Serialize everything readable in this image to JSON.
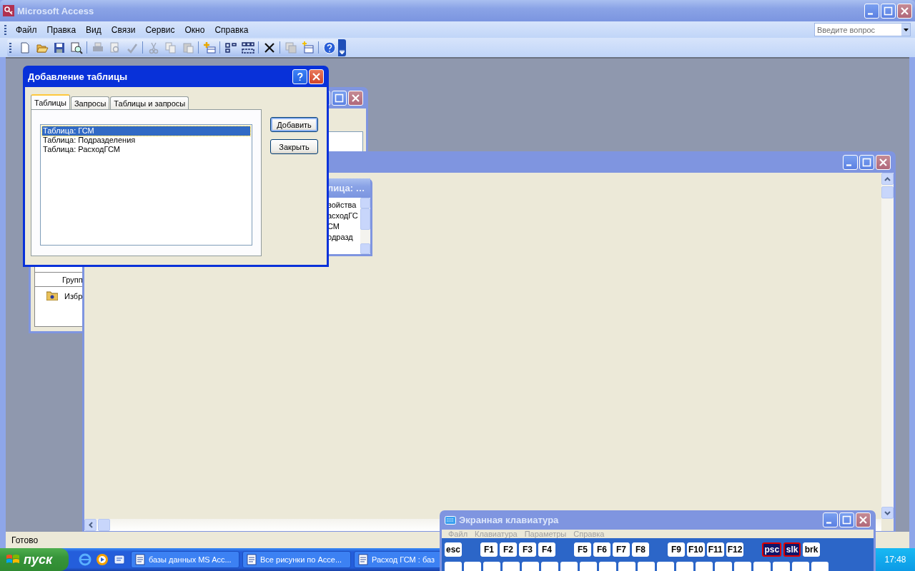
{
  "app": {
    "title": "Microsoft Access"
  },
  "menu": [
    "Файл",
    "Правка",
    "Вид",
    "Связи",
    "Сервис",
    "Окно",
    "Справка"
  ],
  "help_search": {
    "placeholder": "Введите вопрос"
  },
  "database_window": {
    "group_header": "Групп",
    "items": [
      {
        "label": "Избр"
      }
    ]
  },
  "table_box": {
    "title": "лица: …",
    "fields": [
      "войства",
      "асходГС",
      "СМ",
      "одразд"
    ]
  },
  "dialog": {
    "title": "Добавление таблицы",
    "tabs": [
      {
        "label": "Таблицы",
        "selected": true
      },
      {
        "label": "Запросы",
        "selected": false
      },
      {
        "label": "Таблицы и запросы",
        "selected": false
      }
    ],
    "items": [
      {
        "label": "Таблица: ГСМ",
        "selected": true
      },
      {
        "label": "Таблица: Подразделения",
        "selected": false
      },
      {
        "label": "Таблица: РасходГСМ",
        "selected": false
      }
    ],
    "buttons": [
      {
        "label": "Добавить",
        "default": true
      },
      {
        "label": "Закрыть",
        "default": false
      }
    ]
  },
  "status_bar": "Готово",
  "taskbar": {
    "start": "пуск",
    "tasks": [
      "базы данных MS Acc...",
      "Все рисунки по Acce...",
      "Расход ГСМ : баз"
    ],
    "clock": "17:48"
  },
  "keyboard": {
    "title": "Экранная клавиатура",
    "menu": [
      "Файл",
      "Клавиатура",
      "Параметры",
      "Справка"
    ],
    "key_groups": [
      [
        {
          "label": "esc",
          "on": false
        }
      ],
      [
        {
          "label": "F1",
          "on": false
        },
        {
          "label": "F2",
          "on": false
        },
        {
          "label": "F3",
          "on": false
        },
        {
          "label": "F4",
          "on": false
        }
      ],
      [
        {
          "label": "F5",
          "on": false
        },
        {
          "label": "F6",
          "on": false
        },
        {
          "label": "F7",
          "on": false
        },
        {
          "label": "F8",
          "on": false
        }
      ],
      [
        {
          "label": "F9",
          "on": false
        },
        {
          "label": "F10",
          "on": false
        },
        {
          "label": "F11",
          "on": false
        },
        {
          "label": "F12",
          "on": false
        }
      ],
      [
        {
          "label": "psc",
          "on": true
        },
        {
          "label": "slk",
          "on": true
        },
        {
          "label": "brk",
          "on": false
        }
      ]
    ]
  }
}
